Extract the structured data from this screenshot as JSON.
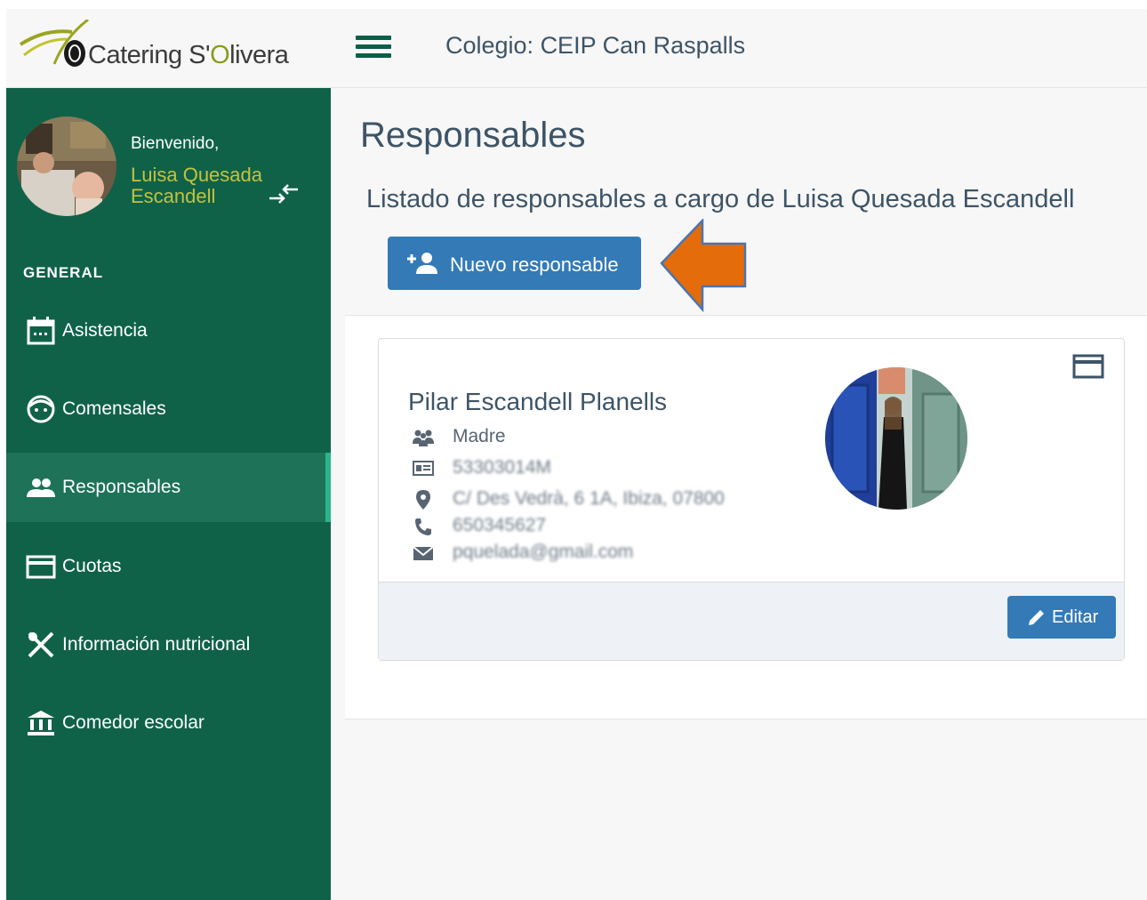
{
  "header": {
    "brand_prefix": "Catering S'",
    "brand_o": "O",
    "brand_suffix": "livera",
    "school": "Colegio: CEIP Can Raspalls"
  },
  "sidebar": {
    "welcome": "Bienvenido,",
    "username": "Luisa Quesada Escandell",
    "section": "GENERAL",
    "items": [
      {
        "label": "Asistencia",
        "icon": "calendar-icon"
      },
      {
        "label": "Comensales",
        "icon": "face-icon"
      },
      {
        "label": "Responsables",
        "icon": "people-icon",
        "active": true
      },
      {
        "label": "Cuotas",
        "icon": "credit-card-icon"
      },
      {
        "label": "Información nutricional",
        "icon": "cutlery-icon"
      },
      {
        "label": "Comedor escolar",
        "icon": "bank-icon"
      }
    ]
  },
  "main": {
    "title": "Responsables",
    "subtitle": "Listado de responsables a cargo de Luisa Quesada Escandell",
    "new_button": "Nuevo responsable"
  },
  "card": {
    "name": "Pilar Escandell Planells",
    "relation": "Madre",
    "dni": "53303014M",
    "address": "C/ Des Vedrà, 6 1A, Ibiza, 07800",
    "phone": "650345627",
    "email": "pquelada@gmail.com",
    "edit_button": "Editar"
  },
  "colors": {
    "sidebar": "#0f6248",
    "accent": "#337ab7",
    "arrow": "#e46c0a"
  }
}
